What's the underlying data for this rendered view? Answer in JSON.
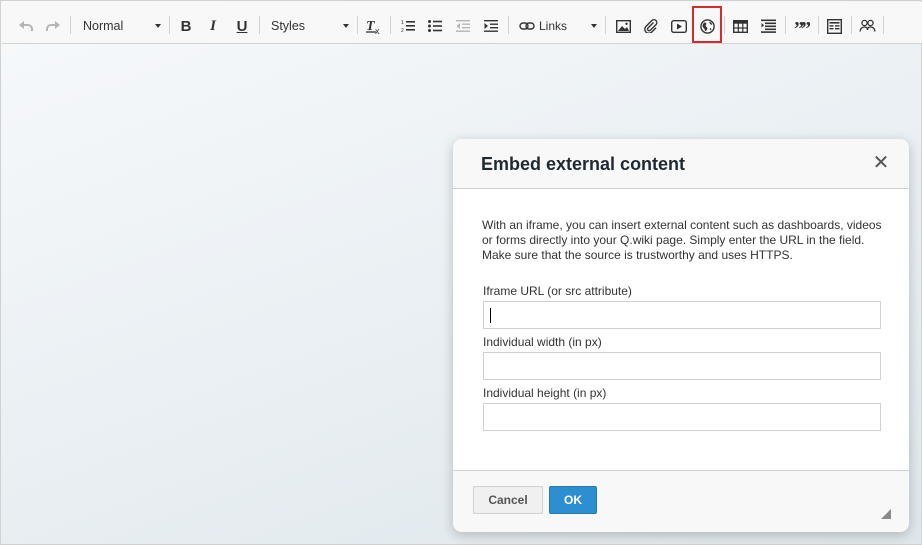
{
  "toolbar": {
    "undo_icon": "undo-arrow",
    "redo_icon": "redo-arrow",
    "format_value": "Normal",
    "bold": "B",
    "italic": "I",
    "underline": "U",
    "styles_value": "Styles",
    "links_label": "Links",
    "quote_glyph": "””"
  },
  "dialog": {
    "title": "Embed external content",
    "close_glyph": "✕",
    "intro": "With an iframe, you can insert external content such as dashboards, videos or forms directly into your Q.wiki page. Simply enter the URL in the field. Make sure that the source is trustworthy and uses HTTPS.",
    "url_label": "Iframe URL (or src attribute)",
    "url_value": "",
    "width_label": "Individual width (in px)",
    "width_value": "",
    "height_label": "Individual height (in px)",
    "height_value": "",
    "cancel_label": "Cancel",
    "ok_label": "OK"
  },
  "colors": {
    "highlight_border": "#d52b2b",
    "ok_button": "#2e8fd0"
  }
}
